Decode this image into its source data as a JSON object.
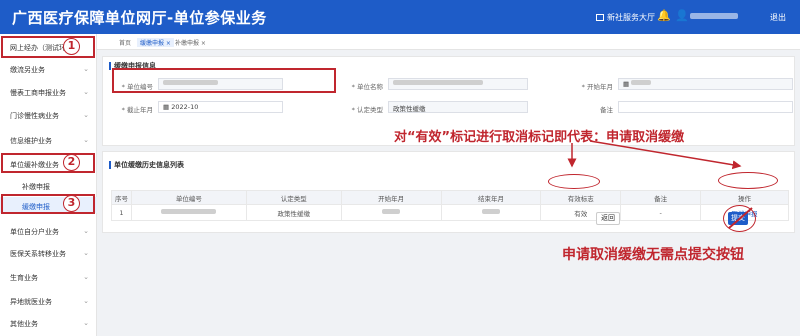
{
  "header": {
    "title": "广西医疗保障单位网厅-单位参保业务",
    "service_hall": "新社服务大厅",
    "logout": "退出"
  },
  "sidebar": {
    "items": [
      {
        "label": "网上经办（测试环境）",
        "chev": "⌃"
      },
      {
        "label": "缴流另业务",
        "chev": "⌄"
      },
      {
        "label": "慢表工商申报业务",
        "chev": "⌄"
      },
      {
        "label": "门诊慢性病业务",
        "chev": "⌄"
      },
      {
        "label": "信息维护业务",
        "chev": "⌄"
      },
      {
        "label": "单位缓补缴业务",
        "chev": "⌃"
      },
      {
        "label": "补缴申报"
      },
      {
        "label": "缓缴申报"
      },
      {
        "label": "单位自分户业务",
        "chev": "⌄"
      },
      {
        "label": "医保关系转移业务",
        "chev": "⌄"
      },
      {
        "label": "生育业务",
        "chev": "⌄"
      },
      {
        "label": "异地就医业务",
        "chev": "⌄"
      },
      {
        "label": "其他业务",
        "chev": "⌄"
      }
    ]
  },
  "tabs": [
    {
      "label": "首页"
    },
    {
      "label": "缓缴申报 ×"
    },
    {
      "label": "补缴申报 ×"
    }
  ],
  "form": {
    "section_title": "缓缴申报信息",
    "unit_no_label": "* 单位编号",
    "unit_name_label": "* 单位名称",
    "start_month_label": "* 开始年月",
    "end_month_label": "* 截止年月",
    "end_month_value": "2022-10",
    "policy_label": "* 认定类型",
    "policy_value": "政策性缓缴",
    "remark_label": "备注"
  },
  "history": {
    "section_title": "单位缓缴历史信息列表",
    "columns": [
      "序号",
      "单位编号",
      "认定类型",
      "开始年月",
      "结束年月",
      "有效标志",
      "备注",
      "操作"
    ],
    "rows": [
      {
        "index": "1",
        "type": "政策性缓缴",
        "flag": "有效",
        "remark": "-",
        "action": "取消申报"
      }
    ]
  },
  "buttons": {
    "back": "返回",
    "submit": "提交"
  },
  "annotations": {
    "num1": "1",
    "num2": "2",
    "num3": "3",
    "top_text": "对“有效”标记进行取消标记即代表：申请取消缓缴",
    "bottom_text": "申请取消缓缴无需点提交按钮"
  },
  "colors": {
    "brand": "#1e5cc8",
    "annotation": "#c0262e"
  }
}
